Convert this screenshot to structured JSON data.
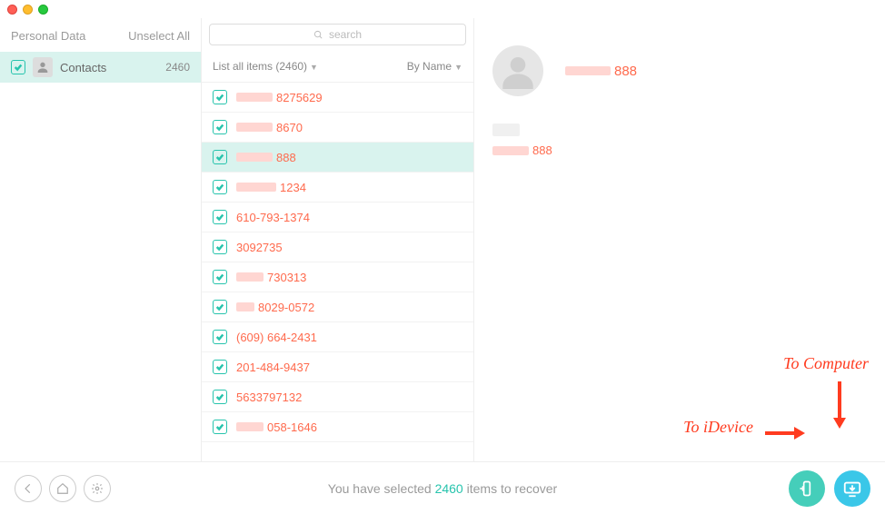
{
  "sidebar": {
    "heading": "Personal Data",
    "unselect": "Unselect All",
    "item": {
      "label": "Contacts",
      "count": "2460"
    }
  },
  "search": {
    "placeholder": "search"
  },
  "listHeader": {
    "left": "List all items (2460)",
    "right": "By Name"
  },
  "contacts": [
    {
      "redact": 40,
      "suffix": "8275629",
      "selected": false
    },
    {
      "redact": 40,
      "suffix": "8670",
      "selected": false
    },
    {
      "redact": 40,
      "suffix": "888",
      "selected": true
    },
    {
      "redact": 44,
      "suffix": "1234",
      "selected": false
    },
    {
      "redact": 0,
      "suffix": "610-793-1374",
      "selected": false
    },
    {
      "redact": 0,
      "suffix": "3092735",
      "selected": false
    },
    {
      "redact": 30,
      "suffix": "730313",
      "selected": false
    },
    {
      "redact": 20,
      "suffix": "8029-0572",
      "selected": false
    },
    {
      "redact": 0,
      "suffix": "(609) 664-2431",
      "selected": false
    },
    {
      "redact": 0,
      "suffix": "201-484-9437",
      "selected": false
    },
    {
      "redact": 0,
      "suffix": "5633797132",
      "selected": false
    },
    {
      "redact": 30,
      "suffix": "058-1646",
      "selected": false
    }
  ],
  "detail": {
    "nameRedact": 50,
    "nameSuffix": "888",
    "phoneRedact": 40,
    "phoneSuffix": "888"
  },
  "footer": {
    "prefix": "You have selected ",
    "count": "2460",
    "suffix": " items to recover"
  },
  "annotations": {
    "device": "To iDevice",
    "computer": "To Computer"
  }
}
